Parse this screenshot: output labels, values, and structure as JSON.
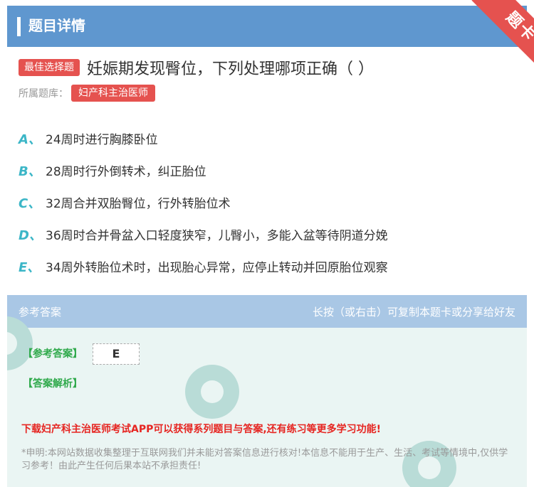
{
  "header": {
    "title": "题目详情"
  },
  "corner": {
    "label": "题卡"
  },
  "question": {
    "type_badge": "最佳选择题",
    "text": "妊娠期发现臀位，下列处理哪项正确（ ）"
  },
  "bank": {
    "label": "所属题库：",
    "name": "妇产科主治医师"
  },
  "options": [
    {
      "letter": "A、",
      "text": "24周时进行胸膝卧位"
    },
    {
      "letter": "B、",
      "text": "28周时行外倒转术，纠正胎位"
    },
    {
      "letter": "C、",
      "text": "32周合并双胎臀位，行外转胎位术"
    },
    {
      "letter": "D、",
      "text": "36周时合并骨盆入口轻度狭窄，儿臀小，多能入盆等待阴道分娩"
    },
    {
      "letter": "E、",
      "text": "34周外转胎位术时，出现胎心异常，应停止转动并回原胎位观察"
    }
  ],
  "answer": {
    "header_left": "参考答案",
    "header_right": "长按（或右击）可复制本题卡或分享给好友",
    "answer_label": "【参考答案】",
    "answer_value": "E",
    "explanation_label": "【答案解析】",
    "promo": "下载妇产科主治医师考试APP可以获得系列题目与答案,还有练习等更多学习功能!",
    "disclaimer": "*申明:本网站数据收集整理于互联网我们并未能对答案信息进行核对!本信息不能用于生产、生活、考试等情境中,仅供学习参考！由此产生任何后果本站不承担责任!"
  },
  "colors": {
    "header": "#5f97cf",
    "badge": "#e5524f",
    "option_letter": "#3cb6c7",
    "answer_label": "#2fa94b",
    "promo": "#e62521"
  }
}
